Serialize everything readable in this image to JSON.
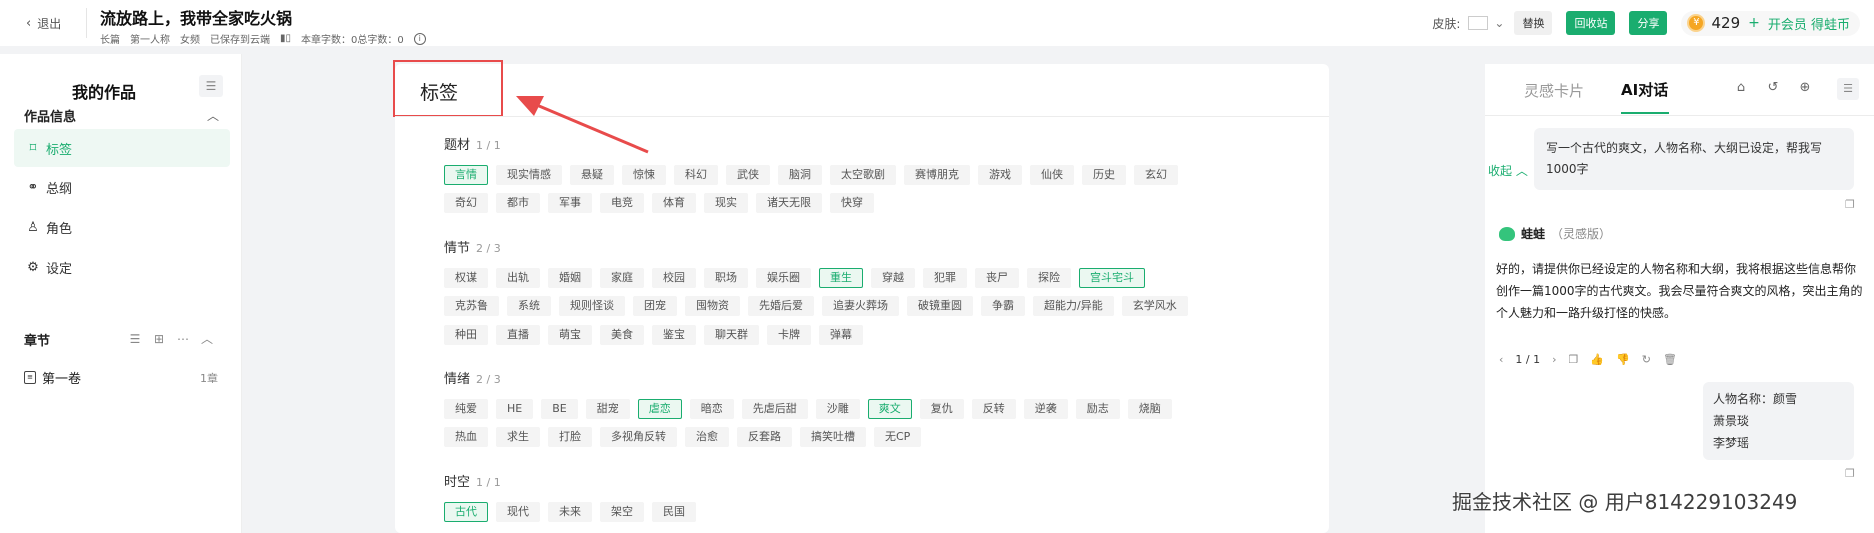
{
  "header": {
    "back_label": "退出",
    "book_title": "流放路上，我带全家吃火锅",
    "meta": [
      "长篇",
      "第一人称",
      "女频",
      "已保存到云端"
    ],
    "word_count": "本章字数：0总字数：0",
    "skin_label": "皮肤:",
    "replace_label": "替换",
    "recycle_label": "回收站",
    "share_label": "分享",
    "coin_count": "429",
    "coin_plus": "+",
    "vip_label": "开会员 得蛙币"
  },
  "sidebar": {
    "title": "我的作品",
    "info_section": "作品信息",
    "items": [
      {
        "label": "标签",
        "icon": "bookmark-icon",
        "active": true
      },
      {
        "label": "总纲",
        "icon": "outline-icon",
        "active": false
      },
      {
        "label": "角色",
        "icon": "person-icon",
        "active": false
      },
      {
        "label": "设定",
        "icon": "settings-doc-icon",
        "active": false
      }
    ],
    "chapter_section": "章节",
    "volume": {
      "label": "第一卷",
      "count": "1章"
    }
  },
  "main": {
    "title": "标签",
    "categories": [
      {
        "name": "题材",
        "count": "1 / 1",
        "rows": [
          [
            {
              "t": "言情",
              "s": true
            },
            {
              "t": "现实情感"
            },
            {
              "t": "悬疑"
            },
            {
              "t": "惊悚"
            },
            {
              "t": "科幻"
            },
            {
              "t": "武侠"
            },
            {
              "t": "脑洞"
            },
            {
              "t": "太空歌剧"
            },
            {
              "t": "赛博朋克"
            },
            {
              "t": "游戏"
            },
            {
              "t": "仙侠"
            },
            {
              "t": "历史"
            },
            {
              "t": "玄幻"
            }
          ],
          [
            {
              "t": "奇幻"
            },
            {
              "t": "都市"
            },
            {
              "t": "军事"
            },
            {
              "t": "电竞"
            },
            {
              "t": "体育"
            },
            {
              "t": "现实"
            },
            {
              "t": "诸天无限"
            },
            {
              "t": "快穿"
            }
          ]
        ]
      },
      {
        "name": "情节",
        "count": "2 / 3",
        "rows": [
          [
            {
              "t": "权谋"
            },
            {
              "t": "出轨"
            },
            {
              "t": "婚姻"
            },
            {
              "t": "家庭"
            },
            {
              "t": "校园"
            },
            {
              "t": "职场"
            },
            {
              "t": "娱乐圈"
            },
            {
              "t": "重生",
              "s": true
            },
            {
              "t": "穿越"
            },
            {
              "t": "犯罪"
            },
            {
              "t": "丧尸"
            },
            {
              "t": "探险"
            },
            {
              "t": "宫斗宅斗",
              "s": true
            }
          ],
          [
            {
              "t": "克苏鲁"
            },
            {
              "t": "系统"
            },
            {
              "t": "规则怪谈"
            },
            {
              "t": "团宠"
            },
            {
              "t": "囤物资"
            },
            {
              "t": "先婚后爱"
            },
            {
              "t": "追妻火葬场"
            },
            {
              "t": "破镜重圆"
            },
            {
              "t": "争霸"
            },
            {
              "t": "超能力/异能"
            },
            {
              "t": "玄学风水"
            }
          ],
          [
            {
              "t": "种田"
            },
            {
              "t": "直播"
            },
            {
              "t": "萌宝"
            },
            {
              "t": "美食"
            },
            {
              "t": "鉴宝"
            },
            {
              "t": "聊天群"
            },
            {
              "t": "卡牌"
            },
            {
              "t": "弹幕"
            }
          ]
        ]
      },
      {
        "name": "情绪",
        "count": "2 / 3",
        "rows": [
          [
            {
              "t": "纯爱"
            },
            {
              "t": "HE"
            },
            {
              "t": "BE"
            },
            {
              "t": "甜宠"
            },
            {
              "t": "虐恋",
              "s": true
            },
            {
              "t": "暗恋"
            },
            {
              "t": "先虐后甜"
            },
            {
              "t": "沙雕"
            },
            {
              "t": "爽文",
              "s": true
            },
            {
              "t": "复仇"
            },
            {
              "t": "反转"
            },
            {
              "t": "逆袭"
            },
            {
              "t": "励志"
            },
            {
              "t": "烧脑"
            }
          ],
          [
            {
              "t": "热血"
            },
            {
              "t": "求生"
            },
            {
              "t": "打脸"
            },
            {
              "t": "多视角反转"
            },
            {
              "t": "治愈"
            },
            {
              "t": "反套路"
            },
            {
              "t": "搞笑吐槽"
            },
            {
              "t": "无CP"
            }
          ]
        ]
      },
      {
        "name": "时空",
        "count": "1 / 1",
        "rows": [
          [
            {
              "t": "古代",
              "s": true
            },
            {
              "t": "现代"
            },
            {
              "t": "未来"
            },
            {
              "t": "架空"
            },
            {
              "t": "民国"
            }
          ]
        ]
      }
    ]
  },
  "right": {
    "tab_inspiration": "灵感卡片",
    "tab_ai": "AI对话",
    "user_msg": "写一个古代的爽文，人物名称、大纲已设定，帮我写1000字",
    "bot_name": "蛙蛙",
    "bot_version": "（灵感版）",
    "fold_label": "收起",
    "bot_reply": "好的，请提供你已经设定的人物名称和大纲，我将根据这些信息帮你创作一篇1000字的古代爽文。我会尽量符合爽文的风格，突出主角的个人魅力和一路升级打怪的快感。",
    "pager": "1 / 1",
    "user_msg2": [
      "人物名称：颜雪",
      "萧景琰",
      "李梦瑶"
    ]
  },
  "watermark": "掘金技术社区 @ 用户814229103249",
  "colors": {
    "accent": "#1aad6f",
    "highlight_box": "#e84b4b"
  }
}
